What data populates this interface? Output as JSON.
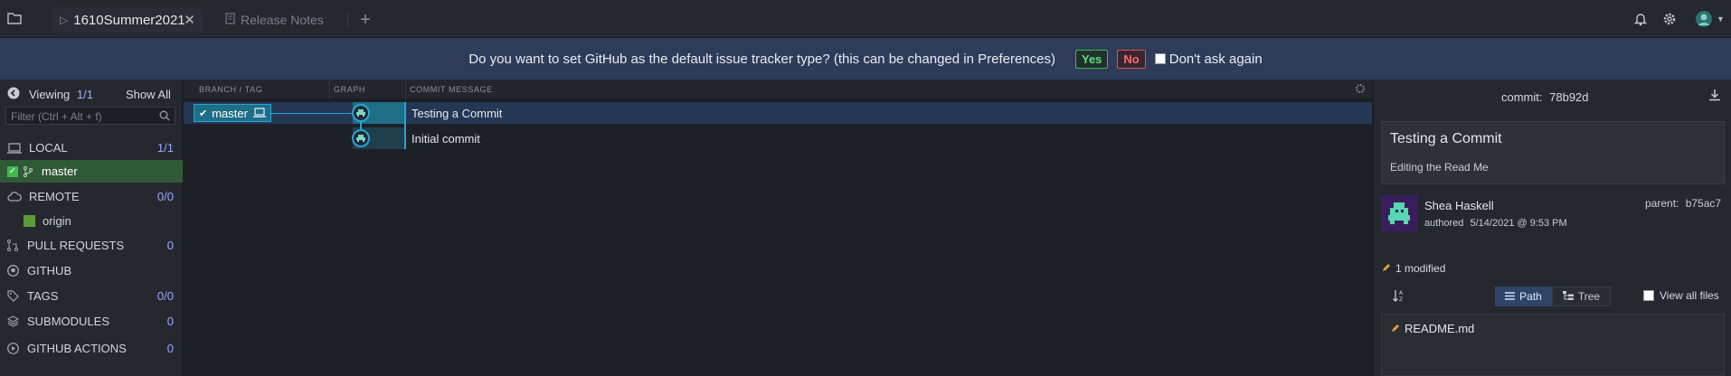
{
  "tabs": {
    "repo": {
      "label": "1610Summer2021",
      "close": "✕"
    },
    "notes": {
      "label": "Release Notes"
    },
    "add": "+"
  },
  "banner": {
    "message": "Do you want to set GitHub as the default issue tracker type? (this can be changed in Preferences)",
    "yes": "Yes",
    "no": "No",
    "dont_ask": "Don't ask again"
  },
  "sidebar": {
    "viewing_label": "Viewing",
    "viewing_count": "1/1",
    "show_all": "Show All",
    "filter_placeholder": "Filter (Ctrl + Alt + f)",
    "sections": [
      {
        "label": "LOCAL",
        "count": "1/1"
      },
      {
        "label": "master"
      },
      {
        "label": "REMOTE",
        "count": "0/0"
      },
      {
        "label": "origin"
      },
      {
        "label": "PULL REQUESTS",
        "count": "0"
      },
      {
        "label": "GITHUB"
      },
      {
        "label": "TAGS",
        "count": "0/0"
      },
      {
        "label": "SUBMODULES",
        "count": "0"
      },
      {
        "label": "GITHUB ACTIONS",
        "count": "0"
      }
    ]
  },
  "graph": {
    "headers": {
      "branch": "BRANCH / TAG",
      "graph": "GRAPH",
      "message": "COMMIT MESSAGE"
    },
    "branch_label": "master",
    "commits": [
      {
        "message": "Testing a Commit"
      },
      {
        "message": "Initial commit"
      }
    ]
  },
  "details": {
    "commit_label": "commit:",
    "commit_sha": "78b92d",
    "summary": "Testing a Commit",
    "description": "Editing the Read Me",
    "author": "Shea Haskell",
    "authored_label": "authored",
    "authored_date": "5/14/2021 @ 9:53 PM",
    "parent_label": "parent:",
    "parent_sha": "b75ac7",
    "modified": "1 modified",
    "view_path": "Path",
    "view_tree": "Tree",
    "view_all_files": "View all files",
    "files": [
      {
        "name": "README.md"
      }
    ]
  },
  "colors": {
    "accent": "#1f6f8b",
    "selected_row": "#243754",
    "banner_bg": "#2e3b59",
    "local_branch_bg": "#2f5a35",
    "graph_node": "#2aa3d6"
  },
  "icons": {
    "folder": "folder-icon",
    "bell": "bell-icon",
    "gear": "gear-icon",
    "avatar": "avatar",
    "back": "back-arrow-icon",
    "search": "search-icon",
    "laptop": "laptop-icon",
    "cloud": "cloud-icon",
    "branch": "branch-icon",
    "pull-request": "pull-request-icon",
    "github": "github-icon",
    "tag": "tag-icon",
    "submodule": "layers-icon",
    "actions": "play-circle-icon",
    "download": "download-icon",
    "pencil": "pencil-icon",
    "sort": "sort-icon"
  }
}
